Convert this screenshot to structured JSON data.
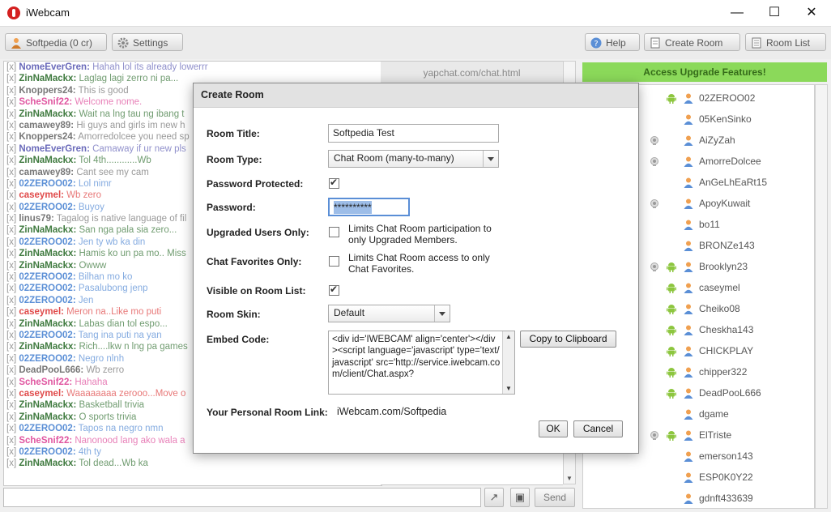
{
  "window": {
    "title": "iWebcam",
    "minimize": "—",
    "maximize": "☐",
    "close": "✕"
  },
  "toolbar": {
    "account_label": "Softpedia (0 cr)",
    "settings_label": "Settings",
    "help_label": "Help",
    "create_room_label": "Create Room",
    "room_list_label": "Room List"
  },
  "chat": {
    "url": "yapchat.com/chat.html",
    "lines": [
      {
        "x": "[x]",
        "name": "NomeEverGren:",
        "msg": "Hahah lol its already lowerrr",
        "color": "#6a6aba"
      },
      {
        "x": "[x]",
        "name": "ZinNaMackx:",
        "msg": "Laglag lagi zerro ni pa...",
        "color": "#3f7a3f"
      },
      {
        "x": "[x]",
        "name": "Knoppers24:",
        "msg": "This is good",
        "color": "#777777"
      },
      {
        "x": "[x]",
        "name": "ScheSnif22:",
        "msg": "Welcome nome.",
        "color": "#e055a0"
      },
      {
        "x": "[x]",
        "name": "ZinNaMackx:",
        "msg": "Wait na lng tau ng ibang t",
        "color": "#3f7a3f"
      },
      {
        "x": "[x]",
        "name": "camawey89:",
        "msg": "Hi guys and girls im new h",
        "color": "#777777"
      },
      {
        "x": "[x]",
        "name": "Knoppers24:",
        "msg": "Amorredolcee you need sp",
        "color": "#777777"
      },
      {
        "x": "[x]",
        "name": "NomeEverGren:",
        "msg": "Camaway if ur new pls",
        "color": "#6a6aba"
      },
      {
        "x": "[x]",
        "name": "ZinNaMackx:",
        "msg": "Tol 4th............Wb",
        "color": "#3f7a3f"
      },
      {
        "x": "[x]",
        "name": "camawey89:",
        "msg": "Cant see my cam",
        "color": "#777777"
      },
      {
        "x": "[x]",
        "name": "02ZEROO02:",
        "msg": "Lol nimr",
        "color": "#5b8fd6"
      },
      {
        "x": "[x]",
        "name": "caseymel:",
        "msg": "Wb zero",
        "color": "#e04a4a"
      },
      {
        "x": "[x]",
        "name": "02ZEROO02:",
        "msg": "Buyoy",
        "color": "#5b8fd6"
      },
      {
        "x": "[x]",
        "name": "linus79:",
        "msg": "Tagalog is native language of fil",
        "color": "#777777"
      },
      {
        "x": "[x]",
        "name": "ZinNaMackx:",
        "msg": "San nga pala sia zero...",
        "color": "#3f7a3f"
      },
      {
        "x": "[x]",
        "name": "02ZEROO02:",
        "msg": "Jen ty wb ka din",
        "color": "#5b8fd6"
      },
      {
        "x": "[x]",
        "name": "ZinNaMackx:",
        "msg": "Hamis ko un pa mo.. Miss",
        "color": "#3f7a3f"
      },
      {
        "x": "[x]",
        "name": "ZinNaMackx:",
        "msg": "Owww",
        "color": "#3f7a3f"
      },
      {
        "x": "[x]",
        "name": "02ZEROO02:",
        "msg": "Bilhan mo ko",
        "color": "#5b8fd6"
      },
      {
        "x": "[x]",
        "name": "02ZEROO02:",
        "msg": "Pasalubong jenp",
        "color": "#5b8fd6"
      },
      {
        "x": "[x]",
        "name": "02ZEROO02:",
        "msg": "Jen",
        "color": "#5b8fd6"
      },
      {
        "x": "[x]",
        "name": "caseymel:",
        "msg": "Meron na..Like mo puti",
        "color": "#e04a4a"
      },
      {
        "x": "[x]",
        "name": "ZinNaMackx:",
        "msg": "Labas dian tol espo...",
        "color": "#3f7a3f"
      },
      {
        "x": "[x]",
        "name": "02ZEROO02:",
        "msg": "Tang ina puti na yan",
        "color": "#5b8fd6"
      },
      {
        "x": "[x]",
        "name": "ZinNaMackx:",
        "msg": "Rich....lkw n lng pa games",
        "color": "#3f7a3f"
      },
      {
        "x": "[x]",
        "name": "02ZEROO02:",
        "msg": "Negro nlnh",
        "color": "#5b8fd6"
      },
      {
        "x": "[x]",
        "name": "DeadPooL666:",
        "msg": "Wb zerro",
        "color": "#777777"
      },
      {
        "x": "[x]",
        "name": "ScheSnif22:",
        "msg": "Hahaha",
        "color": "#e055a0"
      },
      {
        "x": "[x]",
        "name": "caseymel:",
        "msg": "Waaaaaaaa zerooo...Move o",
        "color": "#e04a4a"
      },
      {
        "x": "[x]",
        "name": "ZinNaMackx:",
        "msg": "Basketball trivia",
        "color": "#3f7a3f"
      },
      {
        "x": "[x]",
        "name": "ZinNaMackx:",
        "msg": "O sports trivia",
        "color": "#3f7a3f"
      },
      {
        "x": "[x]",
        "name": "02ZEROO02:",
        "msg": "Tapos na negro nmn",
        "color": "#5b8fd6"
      },
      {
        "x": "[x]",
        "name": "ScheSnif22:",
        "msg": "Nanonood lang ako wala a",
        "color": "#e055a0"
      },
      {
        "x": "[x]",
        "name": "02ZEROO02:",
        "msg": "4th ty",
        "color": "#5b8fd6"
      },
      {
        "x": "[x]",
        "name": "ZinNaMackx:",
        "msg": "Tol dead...Wb ka",
        "color": "#3f7a3f"
      }
    ],
    "send_label": "Send"
  },
  "upgrade_banner": "Access Upgrade Features!",
  "users": [
    {
      "name": "02ZEROO02",
      "android": true,
      "cam": false
    },
    {
      "name": "05KenSinko",
      "android": false,
      "cam": false
    },
    {
      "name": "AiZyZah",
      "android": false,
      "cam": true
    },
    {
      "name": "AmorreDolcee",
      "android": false,
      "cam": true
    },
    {
      "name": "AnGeLhEaRt15",
      "android": false,
      "cam": false
    },
    {
      "name": "ApoyKuwait",
      "android": false,
      "cam": true
    },
    {
      "name": "bo11",
      "android": false,
      "cam": false
    },
    {
      "name": "BRONZe143",
      "android": false,
      "cam": false
    },
    {
      "name": "Brooklyn23",
      "android": true,
      "cam": true
    },
    {
      "name": "caseymel",
      "android": true,
      "cam": false
    },
    {
      "name": "Cheiko08",
      "android": true,
      "cam": false
    },
    {
      "name": "Cheskha143",
      "android": true,
      "cam": false
    },
    {
      "name": "CHICKPLAY",
      "android": true,
      "cam": false
    },
    {
      "name": "chipper322",
      "android": true,
      "cam": false
    },
    {
      "name": "DeadPooL666",
      "android": true,
      "cam": false
    },
    {
      "name": "dgame",
      "android": false,
      "cam": false
    },
    {
      "name": "ElTriste",
      "android": true,
      "cam": true
    },
    {
      "name": "emerson143",
      "android": false,
      "cam": false
    },
    {
      "name": "ESP0K0Y22",
      "android": false,
      "cam": false
    },
    {
      "name": "gdnft433639",
      "android": false,
      "cam": false
    }
  ],
  "dialog": {
    "title": "Create Room",
    "room_title_label": "Room Title:",
    "room_title_value": "Softpedia Test",
    "room_type_label": "Room Type:",
    "room_type_value": "Chat Room (many-to-many)",
    "password_protected_label": "Password Protected:",
    "password_protected": true,
    "password_label": "Password:",
    "password_value": "**********",
    "upgraded_only_label": "Upgraded Users Only:",
    "upgraded_only_hint": "Limits Chat Room participation to only Upgraded Members.",
    "upgraded_only": false,
    "favorites_only_label": "Chat Favorites Only:",
    "favorites_only_hint": "Limits Chat Room access to only Chat Favorites.",
    "favorites_only": false,
    "visible_label": "Visible on Room List:",
    "visible": true,
    "skin_label": "Room Skin:",
    "skin_value": "Default",
    "embed_label": "Embed Code:",
    "embed_value": "<div id='IWEBCAM' align='center'></div><script language='javascript' type='text/javascript' src='http://service.iwebcam.com/client/Chat.aspx?",
    "copy_label": "Copy to Clipboard",
    "link_label": "Your Personal Room Link:",
    "link_value": "iWebcam.com/Softpedia",
    "ok_label": "OK",
    "cancel_label": "Cancel"
  }
}
